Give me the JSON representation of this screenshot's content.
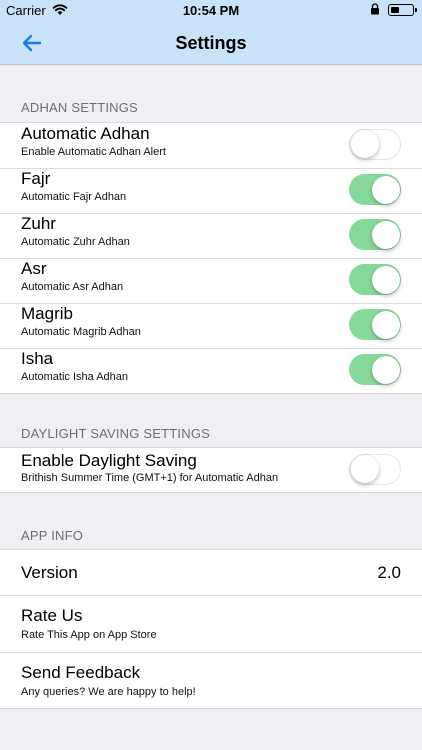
{
  "status_bar": {
    "carrier": "Carrier",
    "time": "10:54 PM",
    "icons": [
      "wifi-icon",
      "lock-icon",
      "battery-icon"
    ]
  },
  "nav": {
    "title": "Settings",
    "back_icon": "arrow-left-icon"
  },
  "colors": {
    "nav_background": "#c9e2f7",
    "accent": "#1a7ae6",
    "toggle_on": "#86d99a",
    "page_background": "#efeff4"
  },
  "adhan_settings": {
    "header": "ADHAN SETTINGS",
    "items": [
      {
        "title": "Automatic Adhan",
        "subtitle": "Enable Automatic Adhan Alert",
        "enabled": false
      },
      {
        "title": "Fajr",
        "subtitle": "Automatic Fajr Adhan",
        "enabled": true
      },
      {
        "title": "Zuhr",
        "subtitle": "Automatic Zuhr Adhan",
        "enabled": true
      },
      {
        "title": "Asr",
        "subtitle": "Automatic Asr Adhan",
        "enabled": true
      },
      {
        "title": "Magrib",
        "subtitle": "Automatic Magrib Adhan",
        "enabled": true
      },
      {
        "title": "Isha",
        "subtitle": "Automatic Isha Adhan",
        "enabled": true
      }
    ]
  },
  "daylight_settings": {
    "header": "DAYLIGHT SAVING SETTINGS",
    "items": [
      {
        "title": "Enable Daylight Saving",
        "subtitle": "Brithish Summer Time (GMT+1) for Automatic Adhan",
        "enabled": false
      }
    ]
  },
  "app_info": {
    "header": "APP INFO",
    "version_label": "Version",
    "version_value": "2.0",
    "rate_title": "Rate Us",
    "rate_subtitle": "Rate This App on App Store",
    "feedback_title": "Send Feedback",
    "feedback_subtitle": "Any queries? We are happy to help!"
  }
}
